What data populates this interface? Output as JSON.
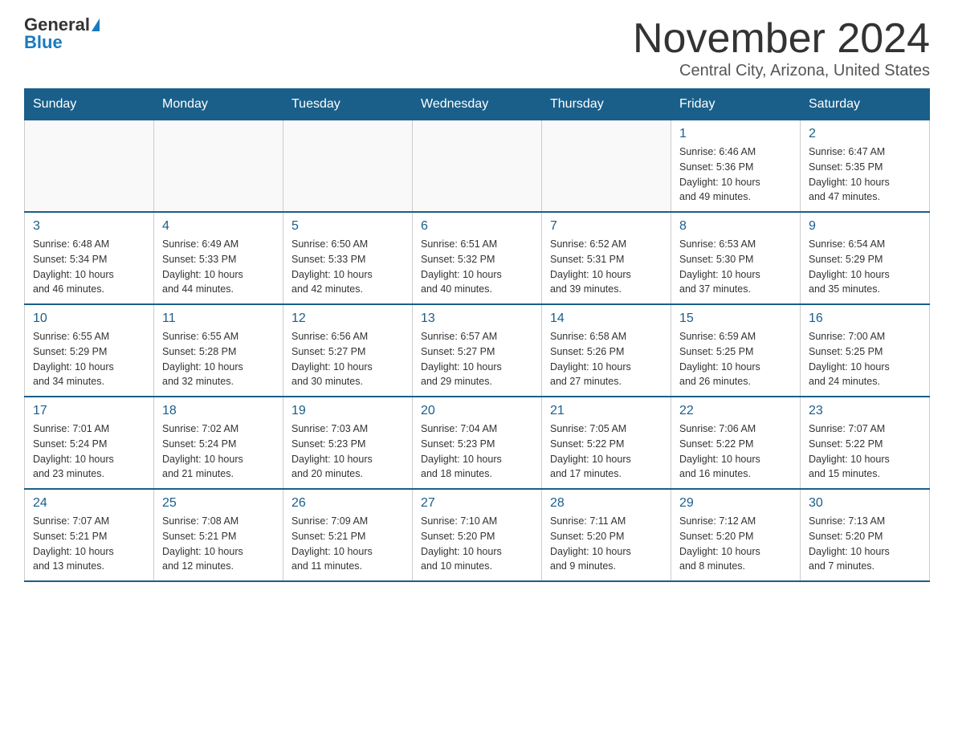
{
  "header": {
    "logo_general": "General",
    "logo_blue": "Blue",
    "title": "November 2024",
    "subtitle": "Central City, Arizona, United States"
  },
  "days_of_week": [
    "Sunday",
    "Monday",
    "Tuesday",
    "Wednesday",
    "Thursday",
    "Friday",
    "Saturday"
  ],
  "weeks": [
    {
      "days": [
        {
          "number": "",
          "info": "",
          "empty": true
        },
        {
          "number": "",
          "info": "",
          "empty": true
        },
        {
          "number": "",
          "info": "",
          "empty": true
        },
        {
          "number": "",
          "info": "",
          "empty": true
        },
        {
          "number": "",
          "info": "",
          "empty": true
        },
        {
          "number": "1",
          "info": "Sunrise: 6:46 AM\nSunset: 5:36 PM\nDaylight: 10 hours\nand 49 minutes."
        },
        {
          "number": "2",
          "info": "Sunrise: 6:47 AM\nSunset: 5:35 PM\nDaylight: 10 hours\nand 47 minutes."
        }
      ]
    },
    {
      "days": [
        {
          "number": "3",
          "info": "Sunrise: 6:48 AM\nSunset: 5:34 PM\nDaylight: 10 hours\nand 46 minutes."
        },
        {
          "number": "4",
          "info": "Sunrise: 6:49 AM\nSunset: 5:33 PM\nDaylight: 10 hours\nand 44 minutes."
        },
        {
          "number": "5",
          "info": "Sunrise: 6:50 AM\nSunset: 5:33 PM\nDaylight: 10 hours\nand 42 minutes."
        },
        {
          "number": "6",
          "info": "Sunrise: 6:51 AM\nSunset: 5:32 PM\nDaylight: 10 hours\nand 40 minutes."
        },
        {
          "number": "7",
          "info": "Sunrise: 6:52 AM\nSunset: 5:31 PM\nDaylight: 10 hours\nand 39 minutes."
        },
        {
          "number": "8",
          "info": "Sunrise: 6:53 AM\nSunset: 5:30 PM\nDaylight: 10 hours\nand 37 minutes."
        },
        {
          "number": "9",
          "info": "Sunrise: 6:54 AM\nSunset: 5:29 PM\nDaylight: 10 hours\nand 35 minutes."
        }
      ]
    },
    {
      "days": [
        {
          "number": "10",
          "info": "Sunrise: 6:55 AM\nSunset: 5:29 PM\nDaylight: 10 hours\nand 34 minutes."
        },
        {
          "number": "11",
          "info": "Sunrise: 6:55 AM\nSunset: 5:28 PM\nDaylight: 10 hours\nand 32 minutes."
        },
        {
          "number": "12",
          "info": "Sunrise: 6:56 AM\nSunset: 5:27 PM\nDaylight: 10 hours\nand 30 minutes."
        },
        {
          "number": "13",
          "info": "Sunrise: 6:57 AM\nSunset: 5:27 PM\nDaylight: 10 hours\nand 29 minutes."
        },
        {
          "number": "14",
          "info": "Sunrise: 6:58 AM\nSunset: 5:26 PM\nDaylight: 10 hours\nand 27 minutes."
        },
        {
          "number": "15",
          "info": "Sunrise: 6:59 AM\nSunset: 5:25 PM\nDaylight: 10 hours\nand 26 minutes."
        },
        {
          "number": "16",
          "info": "Sunrise: 7:00 AM\nSunset: 5:25 PM\nDaylight: 10 hours\nand 24 minutes."
        }
      ]
    },
    {
      "days": [
        {
          "number": "17",
          "info": "Sunrise: 7:01 AM\nSunset: 5:24 PM\nDaylight: 10 hours\nand 23 minutes."
        },
        {
          "number": "18",
          "info": "Sunrise: 7:02 AM\nSunset: 5:24 PM\nDaylight: 10 hours\nand 21 minutes."
        },
        {
          "number": "19",
          "info": "Sunrise: 7:03 AM\nSunset: 5:23 PM\nDaylight: 10 hours\nand 20 minutes."
        },
        {
          "number": "20",
          "info": "Sunrise: 7:04 AM\nSunset: 5:23 PM\nDaylight: 10 hours\nand 18 minutes."
        },
        {
          "number": "21",
          "info": "Sunrise: 7:05 AM\nSunset: 5:22 PM\nDaylight: 10 hours\nand 17 minutes."
        },
        {
          "number": "22",
          "info": "Sunrise: 7:06 AM\nSunset: 5:22 PM\nDaylight: 10 hours\nand 16 minutes."
        },
        {
          "number": "23",
          "info": "Sunrise: 7:07 AM\nSunset: 5:22 PM\nDaylight: 10 hours\nand 15 minutes."
        }
      ]
    },
    {
      "days": [
        {
          "number": "24",
          "info": "Sunrise: 7:07 AM\nSunset: 5:21 PM\nDaylight: 10 hours\nand 13 minutes."
        },
        {
          "number": "25",
          "info": "Sunrise: 7:08 AM\nSunset: 5:21 PM\nDaylight: 10 hours\nand 12 minutes."
        },
        {
          "number": "26",
          "info": "Sunrise: 7:09 AM\nSunset: 5:21 PM\nDaylight: 10 hours\nand 11 minutes."
        },
        {
          "number": "27",
          "info": "Sunrise: 7:10 AM\nSunset: 5:20 PM\nDaylight: 10 hours\nand 10 minutes."
        },
        {
          "number": "28",
          "info": "Sunrise: 7:11 AM\nSunset: 5:20 PM\nDaylight: 10 hours\nand 9 minutes."
        },
        {
          "number": "29",
          "info": "Sunrise: 7:12 AM\nSunset: 5:20 PM\nDaylight: 10 hours\nand 8 minutes."
        },
        {
          "number": "30",
          "info": "Sunrise: 7:13 AM\nSunset: 5:20 PM\nDaylight: 10 hours\nand 7 minutes."
        }
      ]
    }
  ]
}
